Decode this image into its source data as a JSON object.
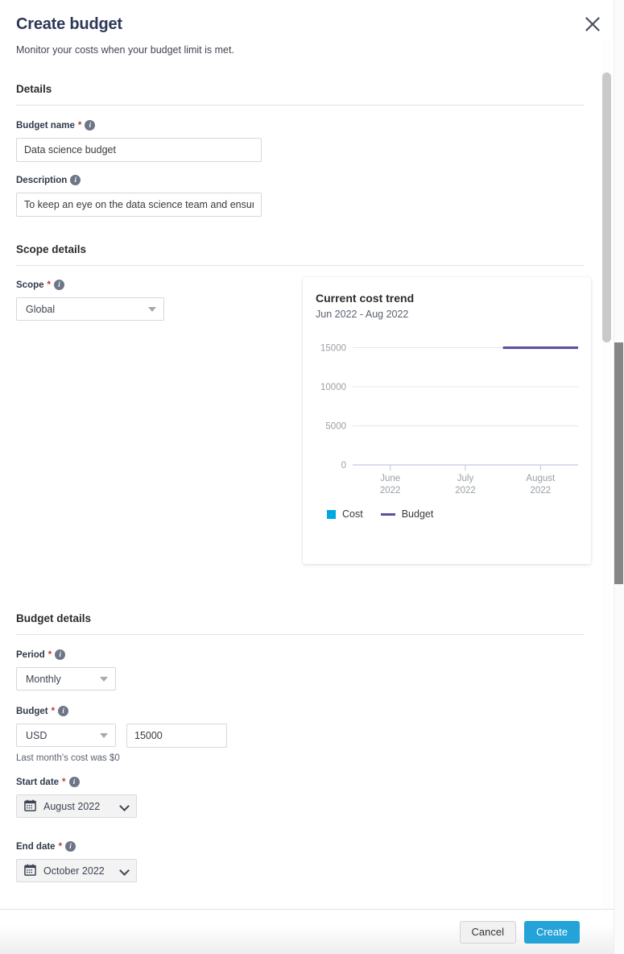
{
  "dialog": {
    "title": "Create budget",
    "subtitle": "Monitor your costs when your budget limit is met.",
    "close_icon": "close-icon"
  },
  "sections": {
    "details": {
      "heading": "Details",
      "budget_name": {
        "label": "Budget name",
        "required": "*",
        "info": "i",
        "value": "Data science budget"
      },
      "description": {
        "label": "Description",
        "info": "i",
        "value": "To keep an eye on the data science team and ensure we stay within our allocated cloud spend."
      }
    },
    "scope_details": {
      "heading": "Scope details",
      "scope": {
        "label": "Scope",
        "required": "*",
        "info": "i",
        "value": "Global"
      }
    },
    "budget_details": {
      "heading": "Budget details",
      "period": {
        "label": "Period",
        "required": "*",
        "info": "i",
        "value": "Monthly"
      },
      "budget": {
        "label": "Budget",
        "required": "*",
        "info": "i",
        "currency": "USD",
        "amount": "15000",
        "helper": "Last month's cost was $0"
      },
      "start_date": {
        "label": "Start date",
        "required": "*",
        "info": "i",
        "value": "August 2022",
        "icon": "calendar-icon"
      },
      "end_date": {
        "label": "End date",
        "required": "*",
        "info": "i",
        "value": "October 2022",
        "icon": "calendar-icon"
      }
    }
  },
  "footer": {
    "cancel_label": "Cancel",
    "create_label": "Create"
  },
  "colors": {
    "cost": "#00a7e1",
    "budget_line": "#5c4f9e",
    "primary_button": "#23a3d8",
    "title": "#2d3858",
    "required": "#c0392b"
  },
  "chart_data": {
    "type": "bar",
    "title": "Current cost trend",
    "subtitle": "Jun 2022 - Aug 2022",
    "categories": [
      "June\n2022",
      "July\n2022",
      "August\n2022"
    ],
    "category_lines": [
      [
        "June",
        "2022"
      ],
      [
        "July",
        "2022"
      ],
      [
        "August",
        "2022"
      ]
    ],
    "series": [
      {
        "name": "Cost",
        "type": "bar",
        "color": "#00a7e1",
        "values": [
          0,
          0,
          0
        ]
      },
      {
        "name": "Budget",
        "type": "line",
        "color": "#5c4f9e",
        "values": [
          null,
          null,
          15000
        ]
      }
    ],
    "yticks": [
      15000,
      10000,
      5000,
      0
    ],
    "ylim": [
      0,
      16500
    ],
    "xlabel": "",
    "ylabel": "",
    "grid": true,
    "legend": [
      "Cost",
      "Budget"
    ],
    "legend_position": "bottom-left"
  }
}
